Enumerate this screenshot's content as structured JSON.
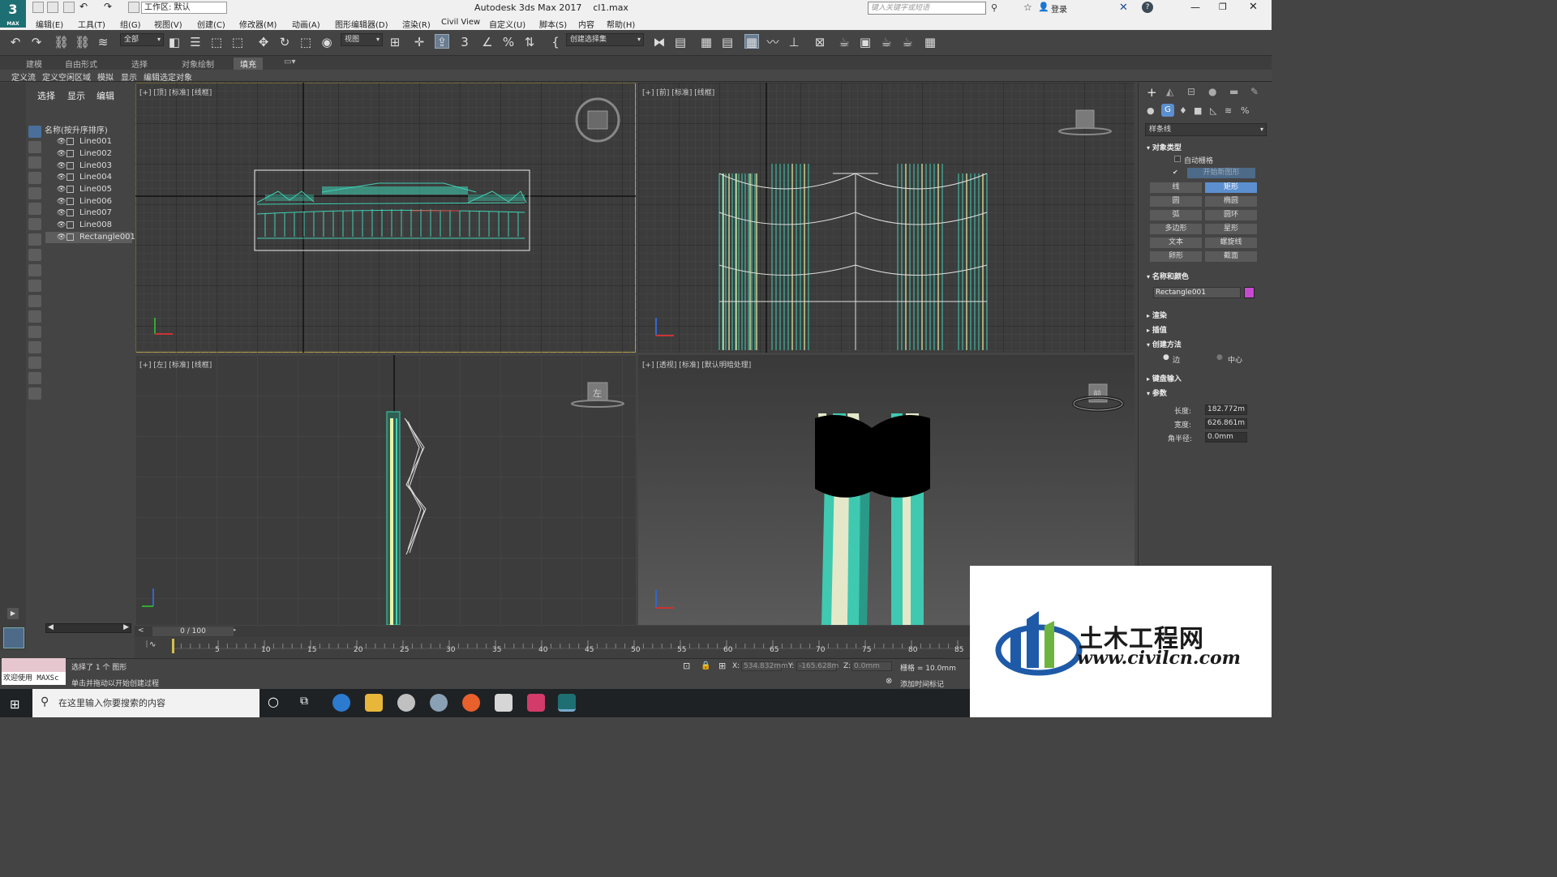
{
  "titlebar": {
    "workspace": "工作区: 默认",
    "app_title": "Autodesk 3ds Max 2017",
    "file_name": "cl1.max",
    "search_placeholder": "键入关键字或短语",
    "login": "登录",
    "logo_label": "MAX",
    "logo_number": "3"
  },
  "menubar": [
    "编辑(E)",
    "工具(T)",
    "组(G)",
    "视图(V)",
    "创建(C)",
    "修改器(M)",
    "动画(A)",
    "图形编辑器(D)",
    "渲染(R)",
    "Civil View",
    "自定义(U)",
    "脚本(S)",
    "内容",
    "帮助(H)"
  ],
  "toolbar": {
    "selection_filter": "全部",
    "reference_coord": "视图",
    "selection_set": "创建选择集",
    "snap_label": "3"
  },
  "ribbon": {
    "tabs": [
      "建模",
      "自由形式",
      "选择",
      "对象绘制",
      "填充"
    ],
    "active_tab": "填充",
    "sub_tabs": [
      "定义流",
      "定义空闲区域",
      "模拟",
      "显示",
      "编辑选定对象"
    ]
  },
  "scene_explorer": {
    "tabs": [
      "选择",
      "显示",
      "编辑"
    ],
    "column_header": "名称(按升序排序)",
    "items": [
      "Line001",
      "Line002",
      "Line003",
      "Line004",
      "Line005",
      "Line006",
      "Line007",
      "Line008",
      "Rectangle001"
    ],
    "selected": "Rectangle001"
  },
  "viewports": {
    "top": "[+] [顶] [标准] [线框]",
    "front": "[+] [前] [标准] [线框]",
    "left": "[+] [左] [标准] [线框]",
    "persp": "[+] [透视] [标准] [默认明暗处理]",
    "cube_front": "前",
    "cube_left": "左"
  },
  "command_panel": {
    "category": "样条线",
    "object_type_header": "对象类型",
    "auto_grid": "自动栅格",
    "start_new_shape": "开始新图形",
    "buttons": [
      "线",
      "矩形",
      "圆",
      "椭圆",
      "弧",
      "圆环",
      "多边形",
      "星形",
      "文本",
      "螺旋线",
      "卵形",
      "截面"
    ],
    "active_button": "矩形",
    "name_color_header": "名称和颜色",
    "object_name": "Rectangle001",
    "object_color": "#c84ad1",
    "render_header": "渲染",
    "interp_header": "插值",
    "creation_method_header": "创建方法",
    "method_edge": "边",
    "method_center": "中心",
    "keyboard_header": "键盘输入",
    "params_header": "参数",
    "length_label": "长度:",
    "length_value": "182.772m",
    "width_label": "宽度:",
    "width_value": "626.861m",
    "corner_label": "角半径:",
    "corner_value": "0.0mm"
  },
  "timeline": {
    "frame": "0 / 100",
    "ticks": [
      "5",
      "10",
      "15",
      "20",
      "25",
      "30",
      "35",
      "40",
      "45",
      "50",
      "55",
      "60",
      "65",
      "70",
      "75",
      "80",
      "85"
    ]
  },
  "status": {
    "welcome": "欢迎使用 MAXSc",
    "selected_msg": "选择了 1 个 图形",
    "prompt": "单击并拖动以开始创建过程",
    "x_label": "X:",
    "x_value": "534.832mm",
    "y_label": "Y:",
    "y_value": "-165.628m",
    "z_label": "Z:",
    "z_value": "0.0mm",
    "grid": "栅格 = 10.0mm",
    "add_time_tag": "添加时间标记"
  },
  "taskbar": {
    "search_placeholder": "在这里输入你要搜索的内容"
  },
  "watermark": {
    "cn": "土木工程网",
    "en": "www.civilcn.com"
  }
}
